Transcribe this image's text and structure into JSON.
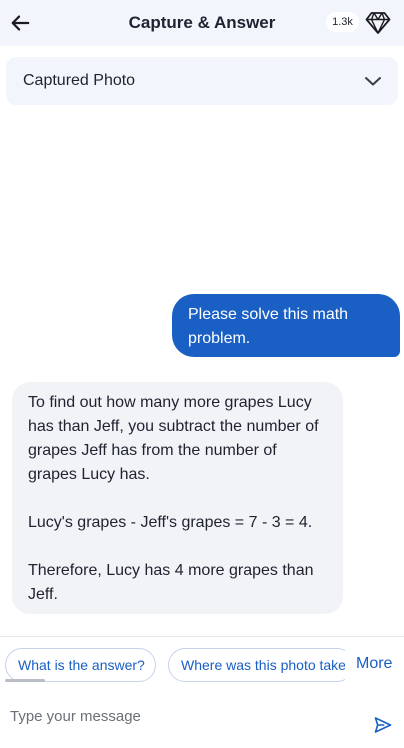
{
  "header": {
    "title": "Capture & Answer",
    "credits": "1.3k",
    "back_icon": "arrow-left-icon",
    "premium_icon": "diamond-icon"
  },
  "photo_panel": {
    "label": "Captured Photo",
    "chevron_icon": "chevron-down-icon"
  },
  "messages": {
    "user": "Please solve this math problem.",
    "assistant": [
      "To find out how many more grapes Lucy has than Jeff, you subtract the number of grapes Jeff has from the number of grapes Lucy has.",
      "Lucy's grapes - Jeff's grapes = 7 - 3 = 4.",
      "Therefore, Lucy has 4 more grapes than Jeff."
    ]
  },
  "suggestions": {
    "chips": [
      "What is the answer?",
      "Where was this photo taken?"
    ],
    "more_label": "More"
  },
  "composer": {
    "placeholder": "Type your message",
    "send_icon": "send-icon"
  },
  "colors": {
    "accent": "#1a5fc4",
    "header_bg": "#f2f5fc",
    "assistant_bubble": "#f1f3f7"
  }
}
